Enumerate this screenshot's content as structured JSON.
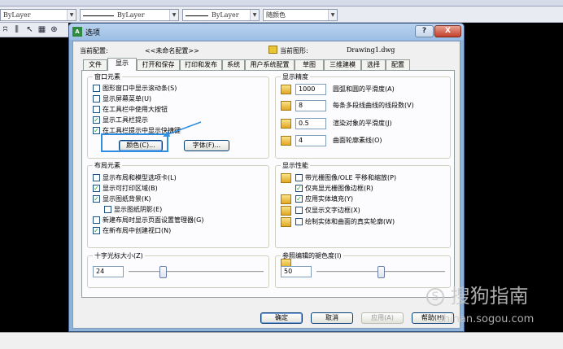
{
  "cad": {
    "layer_combo": "ByLayer",
    "linetype_combo": "ByLayer",
    "lineweight_combo": "ByLayer",
    "color_combo": "随颜色"
  },
  "dialog": {
    "title": "选项",
    "help_btn": "?",
    "close_btn": "X",
    "current_profile_label": "当前配置:",
    "current_profile_value": "<<未命名配置>>",
    "current_drawing_label": "当前图形:",
    "current_drawing_value": "Drawing1.dwg",
    "tabs": [
      "文件",
      "显示",
      "打开和保存",
      "打印和发布",
      "系统",
      "用户系统配置",
      "草图",
      "三维建模",
      "选择",
      "配置"
    ],
    "active_tab": "显示",
    "window_elements": {
      "title": "窗口元素",
      "items": [
        {
          "label": "图形窗口中显示滚动条(S)",
          "checked": false
        },
        {
          "label": "显示屏幕菜单(U)",
          "checked": false
        },
        {
          "label": "在工具栏中使用大按钮",
          "checked": false
        },
        {
          "label": "显示工具栏提示",
          "checked": true
        },
        {
          "label": "在工具栏提示中显示快捷键",
          "checked": true
        }
      ],
      "colors_btn": "颜色(C)...",
      "fonts_btn": "字体(F)..."
    },
    "layout_elements": {
      "title": "布局元素",
      "items": [
        {
          "label": "显示布局和模型选项卡(L)",
          "checked": false
        },
        {
          "label": "显示可打印区域(B)",
          "checked": true
        },
        {
          "label": "显示图纸背景(K)",
          "checked": true
        },
        {
          "label": "显示图纸阴影(E)",
          "checked": false
        },
        {
          "label": "新建布局时显示页面设置管理器(G)",
          "checked": false
        },
        {
          "label": "在新布局中创建视口(N)",
          "checked": true
        }
      ]
    },
    "crosshair": {
      "title": "十字光标大小(Z)",
      "value": "24",
      "level": 0.24
    },
    "display_resolution": {
      "title": "显示精度",
      "items": [
        {
          "value": "1000",
          "label": "圆弧和圆的平滑度(A)"
        },
        {
          "value": "8",
          "label": "每条多段线曲线的线段数(V)"
        },
        {
          "value": "0.5",
          "label": "渲染对象的平滑度(J)"
        },
        {
          "value": "4",
          "label": "曲面轮廓素线(O)"
        }
      ]
    },
    "display_performance": {
      "title": "显示性能",
      "items": [
        {
          "label": "带光栅图像/OLE 平移和缩放(P)",
          "checked": false
        },
        {
          "label": "仅亮显光栅图像边框(R)",
          "checked": true
        },
        {
          "label": "应用实体填充(Y)",
          "checked": true
        },
        {
          "label": "仅显示文字边框(X)",
          "checked": false
        },
        {
          "label": "绘制实体和曲面的真实轮廓(W)",
          "checked": false
        }
      ]
    },
    "xref_fade": {
      "title": "参照编辑的褪色度(I)",
      "value": "50",
      "level": 0.5
    },
    "buttons": {
      "ok": "确定",
      "cancel": "取消",
      "apply": "应用(A)",
      "help": "帮助(H)"
    }
  },
  "watermark": {
    "brand": "搜狗指南",
    "url": "zhinan.sogou.com"
  }
}
